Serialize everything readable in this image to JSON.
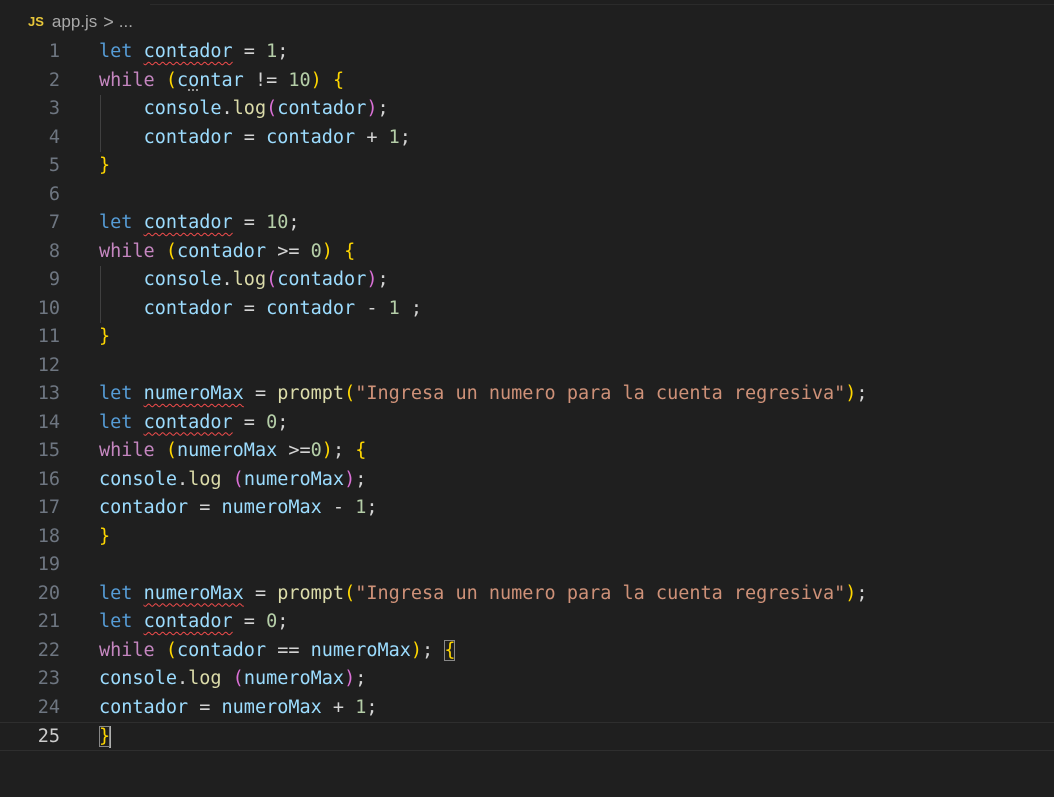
{
  "breadcrumb": {
    "file_icon": "JS",
    "file_name": "app.js",
    "separator": ">",
    "more": "..."
  },
  "editor": {
    "current_line": 25,
    "lines": [
      {
        "n": "1",
        "t": [
          [
            "let",
            "kw"
          ],
          [
            " ",
            "pun"
          ],
          [
            "contador",
            "var squig"
          ],
          [
            " = ",
            "pun"
          ],
          [
            "1",
            "num"
          ],
          [
            ";",
            "pun"
          ]
        ]
      },
      {
        "n": "2",
        "t": [
          [
            "while",
            "ctrl"
          ],
          [
            " ",
            "pun"
          ],
          [
            "(",
            "br1"
          ],
          [
            "c",
            "var"
          ],
          [
            "o",
            "var dotted"
          ],
          [
            "ntar",
            "var"
          ],
          [
            " != ",
            "pun"
          ],
          [
            "10",
            "num"
          ],
          [
            ")",
            "br1"
          ],
          [
            " ",
            "pun"
          ],
          [
            "{",
            "br1"
          ]
        ]
      },
      {
        "n": "3",
        "t": [
          [
            "    ",
            "pun"
          ],
          [
            "console",
            "var"
          ],
          [
            ".",
            "pun"
          ],
          [
            "log",
            "fn"
          ],
          [
            "(",
            "br2"
          ],
          [
            "contador",
            "var"
          ],
          [
            ")",
            "br2"
          ],
          [
            ";",
            "pun"
          ]
        ]
      },
      {
        "n": "4",
        "t": [
          [
            "    ",
            "pun"
          ],
          [
            "contador",
            "var"
          ],
          [
            " = ",
            "pun"
          ],
          [
            "contador",
            "var"
          ],
          [
            " + ",
            "pun"
          ],
          [
            "1",
            "num"
          ],
          [
            ";",
            "pun"
          ]
        ]
      },
      {
        "n": "5",
        "t": [
          [
            "}",
            "br1"
          ]
        ]
      },
      {
        "n": "6",
        "t": []
      },
      {
        "n": "7",
        "t": [
          [
            "let",
            "kw"
          ],
          [
            " ",
            "pun"
          ],
          [
            "contador",
            "var squig"
          ],
          [
            " = ",
            "pun"
          ],
          [
            "10",
            "num"
          ],
          [
            ";",
            "pun"
          ]
        ]
      },
      {
        "n": "8",
        "t": [
          [
            "while",
            "ctrl"
          ],
          [
            " ",
            "pun"
          ],
          [
            "(",
            "br1"
          ],
          [
            "contador",
            "var"
          ],
          [
            " >= ",
            "pun"
          ],
          [
            "0",
            "num"
          ],
          [
            ")",
            "br1"
          ],
          [
            " ",
            "pun"
          ],
          [
            "{",
            "br1"
          ]
        ]
      },
      {
        "n": "9",
        "t": [
          [
            "    ",
            "pun"
          ],
          [
            "console",
            "var"
          ],
          [
            ".",
            "pun"
          ],
          [
            "log",
            "fn"
          ],
          [
            "(",
            "br2"
          ],
          [
            "contador",
            "var"
          ],
          [
            ")",
            "br2"
          ],
          [
            ";",
            "pun"
          ]
        ]
      },
      {
        "n": "10",
        "t": [
          [
            "    ",
            "pun"
          ],
          [
            "contador",
            "var"
          ],
          [
            " = ",
            "pun"
          ],
          [
            "contador",
            "var"
          ],
          [
            " - ",
            "pun"
          ],
          [
            "1",
            "num"
          ],
          [
            " ;",
            "pun"
          ]
        ]
      },
      {
        "n": "11",
        "t": [
          [
            "}",
            "br1"
          ]
        ]
      },
      {
        "n": "12",
        "t": []
      },
      {
        "n": "13",
        "t": [
          [
            "let",
            "kw"
          ],
          [
            " ",
            "pun"
          ],
          [
            "numeroMax",
            "var squig"
          ],
          [
            " = ",
            "pun"
          ],
          [
            "prompt",
            "fn"
          ],
          [
            "(",
            "br1"
          ],
          [
            "\"Ingresa un numero para la cuenta regresiva\"",
            "str"
          ],
          [
            ")",
            "br1"
          ],
          [
            ";",
            "pun"
          ]
        ]
      },
      {
        "n": "14",
        "t": [
          [
            "let",
            "kw"
          ],
          [
            " ",
            "pun"
          ],
          [
            "contador",
            "var squig"
          ],
          [
            " = ",
            "pun"
          ],
          [
            "0",
            "num"
          ],
          [
            ";",
            "pun"
          ]
        ]
      },
      {
        "n": "15",
        "t": [
          [
            "while",
            "ctrl"
          ],
          [
            " ",
            "pun"
          ],
          [
            "(",
            "br1"
          ],
          [
            "numeroMax",
            "var"
          ],
          [
            " >=",
            "pun"
          ],
          [
            "0",
            "num"
          ],
          [
            ")",
            "br1"
          ],
          [
            "; ",
            "pun"
          ],
          [
            "{",
            "br1"
          ]
        ]
      },
      {
        "n": "16",
        "t": [
          [
            "console",
            "var"
          ],
          [
            ".",
            "pun"
          ],
          [
            "log",
            "fn"
          ],
          [
            " ",
            "pun"
          ],
          [
            "(",
            "br2"
          ],
          [
            "numeroMax",
            "var"
          ],
          [
            ")",
            "br2"
          ],
          [
            ";",
            "pun"
          ]
        ]
      },
      {
        "n": "17",
        "t": [
          [
            "contador",
            "var"
          ],
          [
            " = ",
            "pun"
          ],
          [
            "numeroMax",
            "var"
          ],
          [
            " - ",
            "pun"
          ],
          [
            "1",
            "num"
          ],
          [
            ";",
            "pun"
          ]
        ]
      },
      {
        "n": "18",
        "t": [
          [
            "}",
            "br1"
          ]
        ]
      },
      {
        "n": "19",
        "t": []
      },
      {
        "n": "20",
        "t": [
          [
            "let",
            "kw"
          ],
          [
            " ",
            "pun"
          ],
          [
            "numeroMax",
            "var squig"
          ],
          [
            " = ",
            "pun"
          ],
          [
            "prompt",
            "fn"
          ],
          [
            "(",
            "br1"
          ],
          [
            "\"Ingresa un numero para la cuenta regresiva\"",
            "str"
          ],
          [
            ")",
            "br1"
          ],
          [
            ";",
            "pun"
          ]
        ]
      },
      {
        "n": "21",
        "t": [
          [
            "let",
            "kw"
          ],
          [
            " ",
            "pun"
          ],
          [
            "contador",
            "var squig"
          ],
          [
            " = ",
            "pun"
          ],
          [
            "0",
            "num"
          ],
          [
            ";",
            "pun"
          ]
        ]
      },
      {
        "n": "22",
        "t": [
          [
            "while",
            "ctrl"
          ],
          [
            " ",
            "pun"
          ],
          [
            "(",
            "br1"
          ],
          [
            "contador",
            "var"
          ],
          [
            " == ",
            "pun"
          ],
          [
            "numeroMax",
            "var"
          ],
          [
            ")",
            "br1"
          ],
          [
            "; ",
            "pun"
          ],
          [
            "{",
            "br1 match-box"
          ]
        ]
      },
      {
        "n": "23",
        "t": [
          [
            "console",
            "var"
          ],
          [
            ".",
            "pun"
          ],
          [
            "log",
            "fn"
          ],
          [
            " ",
            "pun"
          ],
          [
            "(",
            "br2"
          ],
          [
            "numeroMax",
            "var"
          ],
          [
            ")",
            "br2"
          ],
          [
            ";",
            "pun"
          ]
        ]
      },
      {
        "n": "24",
        "t": [
          [
            "contador",
            "var"
          ],
          [
            " = ",
            "pun"
          ],
          [
            "numeroMax",
            "var"
          ],
          [
            " + ",
            "pun"
          ],
          [
            "1",
            "num"
          ],
          [
            ";",
            "pun"
          ]
        ]
      },
      {
        "n": "25",
        "t": [
          [
            "}",
            "br1 match-box"
          ]
        ],
        "cursor": true
      }
    ]
  },
  "colors": {
    "background": "#1f1f1f",
    "keyword": "#569cd6",
    "control": "#c586c0",
    "variable": "#9cdcfe",
    "function": "#dcdcaa",
    "number": "#b5cea8",
    "string": "#ce9178",
    "bracket_level1": "#ffd700",
    "bracket_level2": "#da70d6",
    "error_squiggle": "#f14c4c"
  }
}
